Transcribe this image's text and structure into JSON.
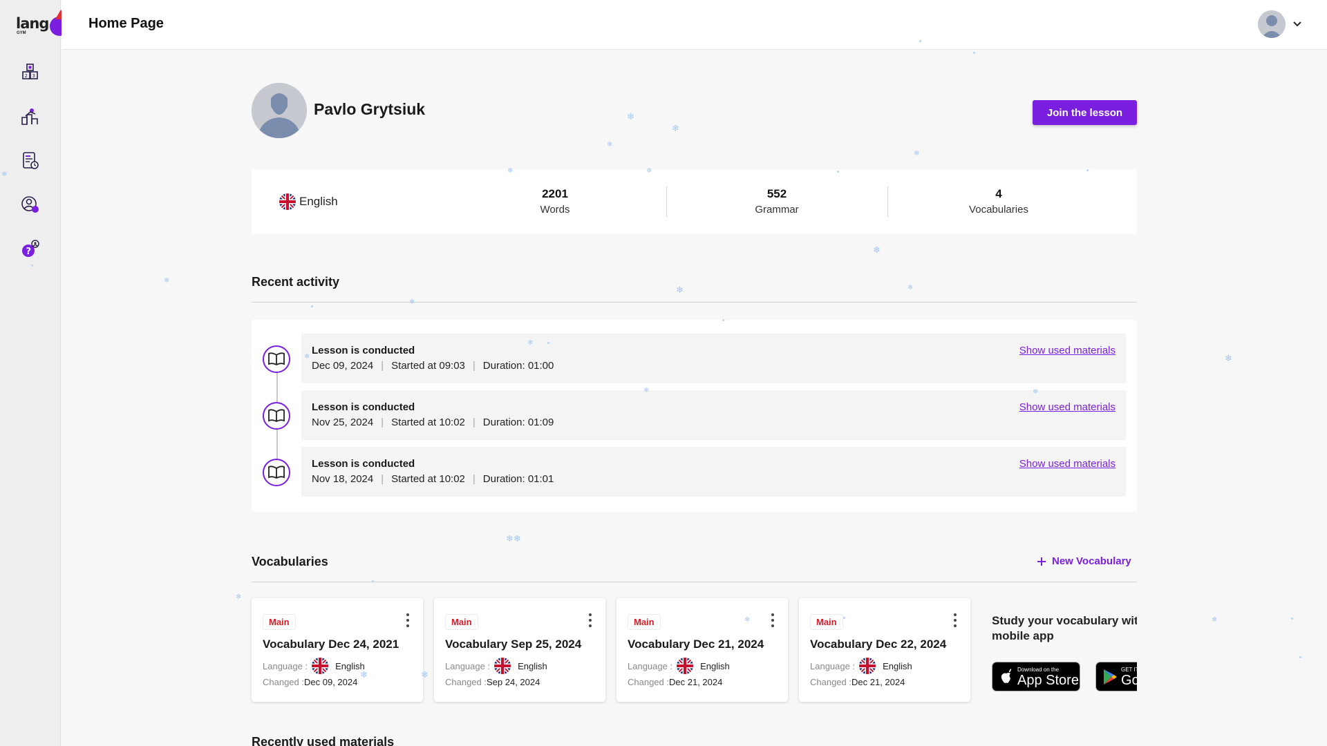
{
  "app": {
    "logo_text": "lang",
    "logo_sub": "GYM"
  },
  "sidebar": {
    "items": [
      {
        "icon": "dashboard-blocks-icon"
      },
      {
        "icon": "lessons-icon"
      },
      {
        "icon": "materials-icon"
      },
      {
        "icon": "students-icon"
      },
      {
        "icon": "help-icon"
      }
    ]
  },
  "header": {
    "title": "Home Page",
    "user_menu_icon": "chevron-down-icon"
  },
  "profile": {
    "name": "Pavlo Grytsiuk",
    "join_label": "Join the lesson"
  },
  "stats": {
    "language": "English",
    "items": [
      {
        "value": "2201",
        "label": "Words"
      },
      {
        "value": "552",
        "label": "Grammar"
      },
      {
        "value": "4",
        "label": "Vocabularies"
      }
    ]
  },
  "recent_activity": {
    "title": "Recent activity",
    "items": [
      {
        "title": "Lesson is conducted",
        "date": "Dec 09, 2024",
        "started": "Started at 09:03",
        "duration": "Duration: 01:00",
        "link": "Show used materials"
      },
      {
        "title": "Lesson is conducted",
        "date": "Nov 25, 2024",
        "started": "Started at 10:02",
        "duration": "Duration: 01:09",
        "link": "Show used materials"
      },
      {
        "title": "Lesson is conducted",
        "date": "Nov 18, 2024",
        "started": "Started at 10:02",
        "duration": "Duration: 01:01",
        "link": "Show used materials"
      }
    ]
  },
  "vocabularies": {
    "title": "Vocabularies",
    "new_label": "New Vocabulary",
    "language_key": "Language :",
    "changed_key": "Changed :",
    "cards": [
      {
        "badge": "Main",
        "title": "Vocabulary Dec 24, 2021",
        "language": "English",
        "changed": "Dec 09, 2024"
      },
      {
        "badge": "Main",
        "title": "Vocabulary Sep 25, 2024",
        "language": "English",
        "changed": "Sep 24, 2024"
      },
      {
        "badge": "Main",
        "title": "Vocabulary Dec 21, 2024",
        "language": "English",
        "changed": "Dec 21, 2024"
      },
      {
        "badge": "Main",
        "title": "Vocabulary Dec 22, 2024",
        "language": "English",
        "changed": "Dec 21, 2024"
      }
    ],
    "promo_line1": "Study your vocabulary wit",
    "promo_line2": "mobile app",
    "app_store": {
      "small": "Download on the",
      "big": "App Store"
    },
    "google_play": {
      "small": "GET IT ON",
      "big": "Google Play"
    }
  },
  "recent_materials": {
    "title": "Recently used materials"
  },
  "colors": {
    "accent": "#7a1fe0",
    "badge_red": "#d21f2b",
    "snow": "#a8c8ef"
  }
}
